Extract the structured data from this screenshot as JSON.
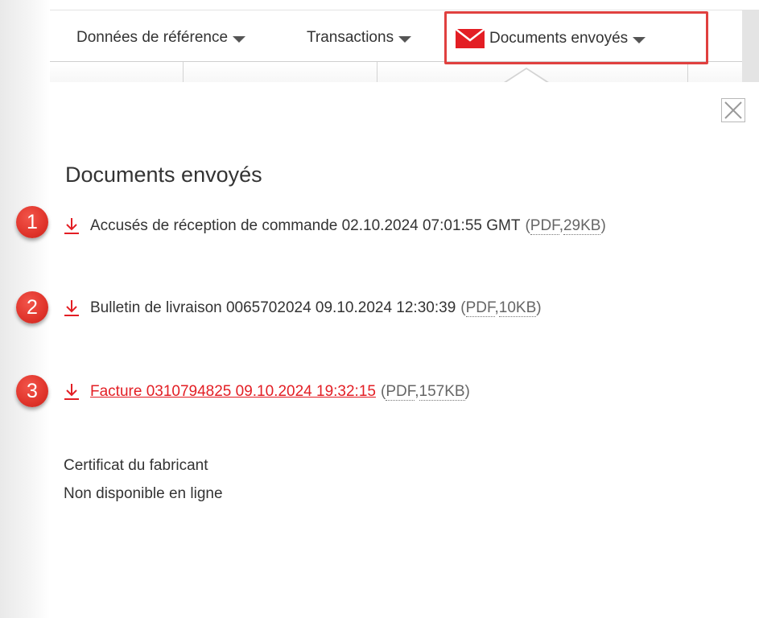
{
  "nav": {
    "items": [
      {
        "label": "Données de référence"
      },
      {
        "label": "Transactions"
      },
      {
        "label": "Documents envoyés"
      }
    ]
  },
  "panel": {
    "title": "Documents envoyés",
    "documents": [
      {
        "badge": "1",
        "label": "Accusés de réception de commande 02.10.2024 07:01:55 GMT",
        "format": "PDF",
        "size": "29KB"
      },
      {
        "badge": "2",
        "label": "Bulletin de livraison 0065702024 09.10.2024 12:30:39",
        "format": "PDF",
        "size": "10KB"
      },
      {
        "badge": "3",
        "label": "Facture 0310794825 09.10.2024 19:32:15",
        "format": "PDF",
        "size": "157KB"
      }
    ],
    "certificate": {
      "title": "Certificat du fabricant",
      "status": "Non disponible en ligne"
    }
  },
  "colors": {
    "accent_red": "#e31e24",
    "highlight_border": "#e0403f",
    "badge_red": "#e0342b"
  },
  "icons": {
    "nav_documents": "envelope-icon",
    "document": "download-icon",
    "close": "close-icon",
    "dropdown": "caret-down-icon"
  }
}
